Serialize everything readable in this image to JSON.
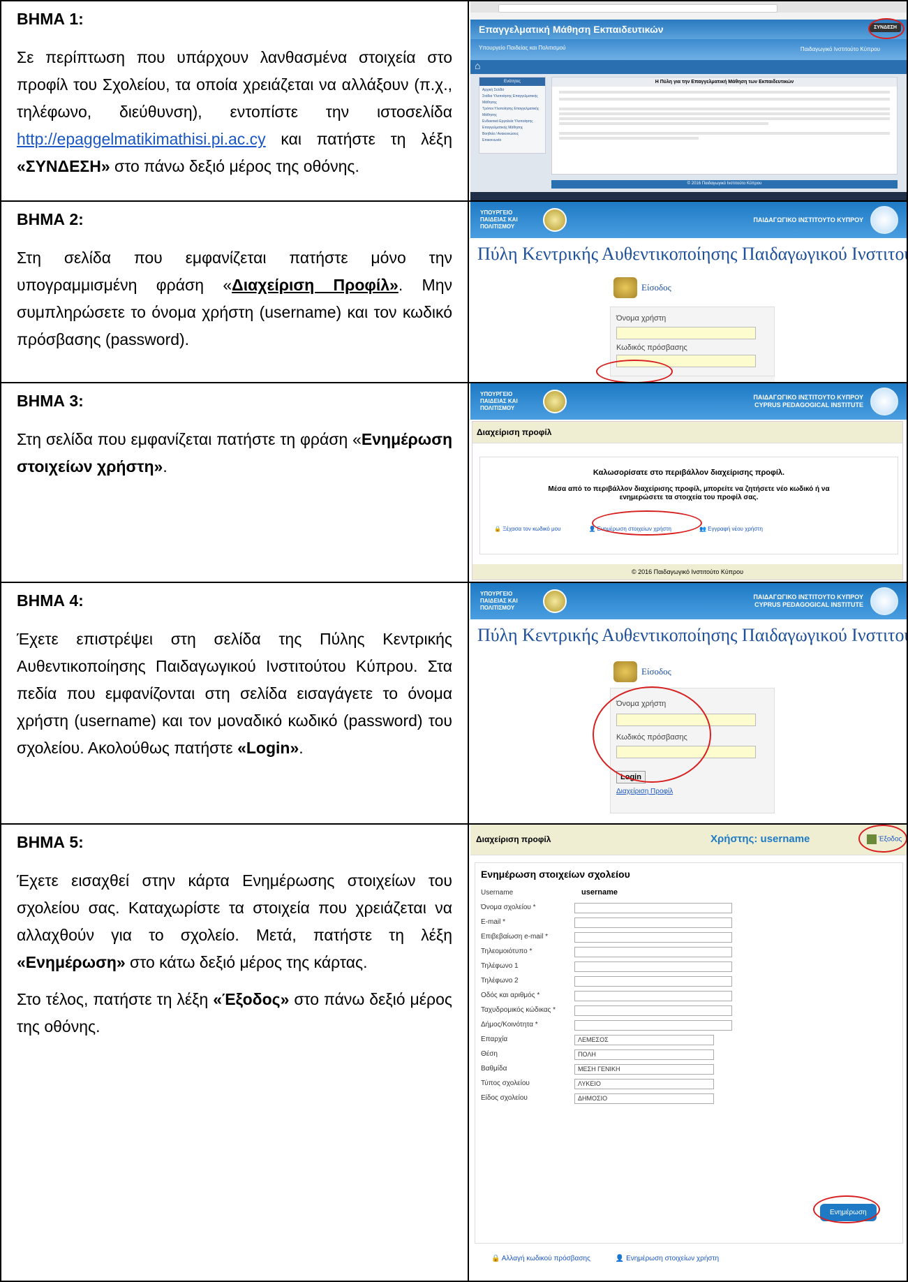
{
  "steps": [
    {
      "title": "ΒΗΜΑ 1",
      "sep": ":",
      "p1": "Σε περίπτωση που υπάρχουν λανθασμένα στοιχεία στο προφίλ του Σχολείου, τα οποία χρειάζεται να αλλάξουν (π.χ., τηλέφωνο, διεύθυνση), εντοπίστε την ιστοσελίδα ",
      "link": "http://epaggelmatikimathisi.pi.ac.cy",
      "p2": " και πατήστε τη λέξη ",
      "bold": "«ΣΥΝΔΕΣΗ»",
      "p3": " στο πάνω δεξιό μέρος της οθόνης."
    },
    {
      "title": "ΒΗΜΑ 2",
      "sep": ":",
      "p1": "Στη σελίδα που εμφανίζεται πατήστε μόνο την υπογραμμισμένη φράση «",
      "bold": "Διαχείριση Προφίλ»",
      "p2": ". Μην συμπληρώσετε το όνομα χρήστη (username) και τον κωδικό πρόσβασης (password)."
    },
    {
      "title": "ΒΗΜΑ 3",
      "sep": ":",
      "p1": "Στη σελίδα που εμφανίζεται πατήστε τη φράση «",
      "bold": "Ενημέρωση στοιχείων χρήστη»",
      "p2": "."
    },
    {
      "title": "ΒΗΜΑ 4:",
      "p1": "Έχετε επιστρέψει στη σελίδα της Πύλης Κεντρικής Αυθεντικοποίησης Παιδαγωγικού Ινστιτούτου Κύπρου. Στα πεδία που εμφανίζονται στη σελίδα εισαγάγετε το όνομα χρήστη (username) και τον μοναδικό κωδικό (password) του σχολείου. Ακολούθως πατήστε ",
      "bold": "«Login»",
      "p2": "."
    },
    {
      "title": "ΒΗΜΑ 5:",
      "p1": "Έχετε εισαχθεί στην κάρτα Ενημέρωσης στοιχείων του σχολείου σας. Καταχωρίστε τα στοιχεία που χρειάζεται να αλλαχθούν για το σχολείο. Μετά, πατήστε τη λέξη ",
      "bold": "«Ενημέρωση»",
      "p2": " στο κάτω δεξιό μέρος της κάρτας.",
      "p3": "Στο τέλος, πατήστε τη λέξη ",
      "bold2": "«Έξοδος»",
      "p4": " στο πάνω δεξιό μέρος της οθόνης."
    }
  ],
  "shot1": {
    "site_title": "Επαγγελματική Μάθηση Εκπαιδευτικών",
    "ministry": "Υπουργείο Παιδείας και Πολιτισμού",
    "institute": "Παιδαγωγικό Ινστιτούτο Κύπρου",
    "heading": "Η Πύλη για την Επαγγελματική Μάθηση των Εκπαιδευτικών",
    "login": "ΣΥΝΔΕΣΗ",
    "menu_head": "Ενότητες",
    "menu": [
      "Αρχική Σελίδα",
      "Στάδια Υλοποίησης Επαγγελματικής Μάθησης",
      "Τρόποι Υλοποίησης Επαγγελματικής Μάθησης",
      "Ενδεικτικά Εργαλεία Υλοποίησης Επαγγελματικής Μάθησης",
      "Βοηθεία / Ανακοινώσεις",
      "Επικοινωνία"
    ],
    "footer": "© 2016 Παιδαγωγικό Ινστιτούτο Κύπρου"
  },
  "portal": {
    "ministry": "ΥΠΟΥΡΓΕΙΟ ΠΑΙΔΕΙΑΣ ΚΑΙ ΠΟΛΙΤΙΣΜΟΥ",
    "institute": "ΠΑΙΔΑΓΩΓΙΚΟ ΙΝΣΤΙΤΟΥΤΟ ΚΥΠΡΟΥ",
    "institute_en": "CYPRUS PEDAGOGICAL INSTITUTE",
    "title": "Πύλη Κεντρικής Αυθεντικοποίησης Παιδαγωγικού Ινστιτούτου Κύπρου",
    "eisodos": "Είσοδος",
    "username_label": "Όνομα χρήστη",
    "password_label": "Κωδικός πρόσβασης",
    "login": "Login",
    "profile_link": "Διαχείριση Προφίλ"
  },
  "shot3": {
    "header": "Διαχείριση προφίλ",
    "welcome": "Καλωσορίσατε στο περιβάλλον διαχείρισης προφίλ.",
    "body": "Μέσα από το περιβάλλον διαχείρισης προφίλ, μπορείτε να ζητήσετε νέο κωδικό ή να ενημερώσετε τα στοιχεία του προφίλ σας.",
    "link1": "Ξέχασα τον κωδικό μου",
    "link2": "Ενημέρωση στοιχείων χρήστη",
    "link3": "Εγγραφή νέου χρήστη",
    "footer": "© 2016 Παιδαγωγικό Ινστιτούτο Κύπρου"
  },
  "shot5": {
    "header": "Διαχείριση προφίλ",
    "user_label": "Χρήστης: username",
    "exit": "Έξοδος",
    "form_title": "Ενημέρωση στοιχείων σχολείου",
    "fields": [
      {
        "label": "Username",
        "value": "username",
        "kind": "text"
      },
      {
        "label": "Όνομα σχολείου *",
        "value": "",
        "kind": "input"
      },
      {
        "label": "E-mail *",
        "value": "",
        "kind": "input"
      },
      {
        "label": "Επιβεβαίωση e-mail *",
        "value": "",
        "kind": "input"
      },
      {
        "label": "Τηλεομοιότυπο *",
        "value": "",
        "kind": "input"
      },
      {
        "label": "Τηλέφωνο 1",
        "value": "",
        "kind": "input"
      },
      {
        "label": "Τηλέφωνο 2",
        "value": "",
        "kind": "input"
      },
      {
        "label": "Οδός και αριθμός *",
        "value": "",
        "kind": "input"
      },
      {
        "label": "Ταχυδρομικός κώδικας *",
        "value": "",
        "kind": "input"
      },
      {
        "label": "Δήμος/Κοινότητα *",
        "value": "",
        "kind": "input"
      },
      {
        "label": "Επαρχία",
        "value": "ΛΕΜΕΣΟΣ",
        "kind": "select"
      },
      {
        "label": "Θέση",
        "value": "ΠΟΛΗ",
        "kind": "select"
      },
      {
        "label": "Βαθμίδα",
        "value": "ΜΕΣΗ ΓΕΝΙΚΗ",
        "kind": "select"
      },
      {
        "label": "Τύπος σχολείου",
        "value": "ΛΥΚΕΙΟ",
        "kind": "select"
      },
      {
        "label": "Είδος σχολείου",
        "value": "ΔΗΜΟΣΙΟ",
        "kind": "select"
      }
    ],
    "update_button": "Ενημέρωση",
    "link1": "Αλλαγή κωδικού πρόσβασης",
    "link2": "Ενημέρωση στοιχείων χρήστη"
  },
  "colors": {
    "accent_red": "#d81f1f",
    "link_blue": "#1a56c4",
    "banner_blue": "#1e7ac4"
  }
}
